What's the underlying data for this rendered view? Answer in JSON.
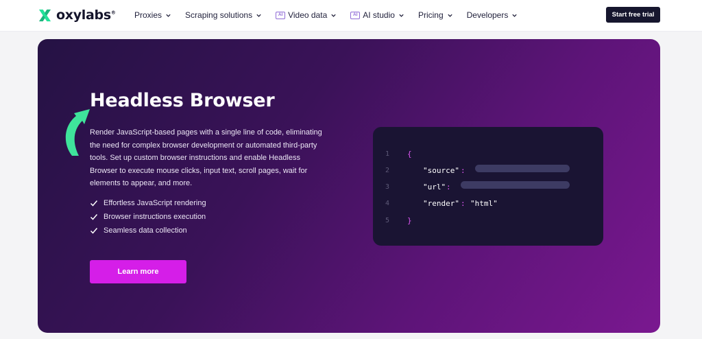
{
  "navbar": {
    "logo_text": "oxylabs",
    "logo_reg": "®",
    "items": [
      {
        "label": "Proxies",
        "badge": ""
      },
      {
        "label": "Scraping solutions",
        "badge": ""
      },
      {
        "label": "Video data",
        "badge": "AI"
      },
      {
        "label": "AI studio",
        "badge": "AI"
      },
      {
        "label": "Pricing",
        "badge": ""
      },
      {
        "label": "Developers",
        "badge": ""
      }
    ],
    "cta_label": "Start free trial"
  },
  "hero": {
    "title": "Headless Browser",
    "description": "Render JavaScript-based pages with a single line of code, eliminating the need for complex browser development or automated third-party tools. Set up custom browser instructions and enable Headless Browser to execute mouse clicks, input text, scroll pages, wait for elements to appear, and more.",
    "features": [
      "Effortless JavaScript rendering",
      "Browser instructions execution",
      "Seamless data collection"
    ],
    "button_label": "Learn more"
  },
  "code": {
    "line_numbers": [
      "1",
      "2",
      "3",
      "4",
      "5"
    ],
    "open_brace": "{",
    "close_brace": "}",
    "key_source": "\"source\"",
    "key_url": "\"url\"",
    "key_render": "\"render\"",
    "value_render": "\"html\"",
    "colon": ":"
  },
  "colors": {
    "accent_button": "#d51ee8",
    "nav_cta": "#16162e",
    "logo_green": "#23e29a",
    "code_bg": "#1a1433"
  },
  "icons": {
    "logo": "oxylabs-x-icon",
    "nav_chevron": "chevron-down-icon",
    "feature_check": "check-icon",
    "decor": "curved-arrow-icon"
  }
}
